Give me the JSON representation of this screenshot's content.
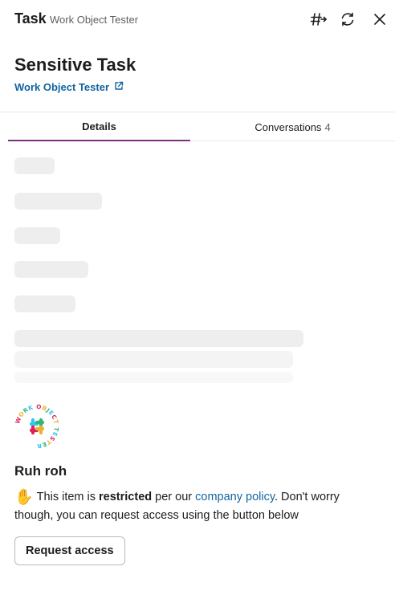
{
  "header": {
    "title": "Task",
    "subtitle": "Work Object Tester",
    "icons": [
      "channel-share-icon",
      "refresh-icon",
      "close-icon"
    ]
  },
  "item": {
    "title": "Sensitive Task",
    "app_link_label": "Work Object Tester",
    "app_link_icon": "external-link-icon"
  },
  "tabs": [
    {
      "label": "Details",
      "active": true
    },
    {
      "label": "Conversations",
      "count": "4",
      "active": false
    }
  ],
  "colors": {
    "accent": "#7c3085",
    "link": "#1264a3",
    "skeleton": "#eeeeee"
  },
  "restricted": {
    "logo_text": "WORK OBJECT TESTER",
    "heading": "Ruh roh",
    "emoji": "✋",
    "text_before": "This item is",
    "text_bold": "restricted",
    "text_mid": "per our",
    "link_text": "company policy",
    "text_after": ". Don't worry though, you can request access using the button below",
    "button_label": "Request access"
  }
}
